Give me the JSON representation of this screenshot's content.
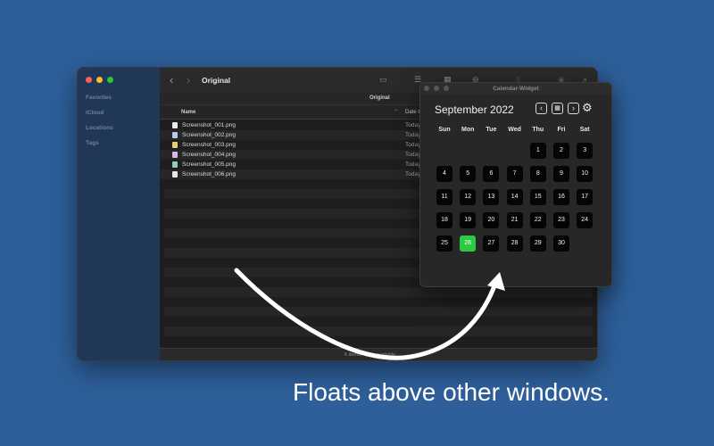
{
  "colors": {
    "background": "#2e5f9a",
    "sidebar": "#213757",
    "today": "#2ec944"
  },
  "finder": {
    "sidebar": [
      "Favorites",
      "iCloud",
      "Locations",
      "Tags"
    ],
    "title": "Original",
    "path_label": "Original",
    "columns": {
      "name": "Name",
      "date": "Date C"
    },
    "files": [
      {
        "name": "Screenshot_001.png",
        "date": "Today",
        "icon_color": "#e8e8e8"
      },
      {
        "name": "Screenshot_002.png",
        "date": "Today",
        "icon_color": "#b9c7e8"
      },
      {
        "name": "Screenshot_003.png",
        "date": "Today",
        "icon_color": "#e8cf6a"
      },
      {
        "name": "Screenshot_004.png",
        "date": "Today",
        "icon_color": "#d9b7e6"
      },
      {
        "name": "Screenshot_005.png",
        "date": "Today",
        "icon_color": "#8fd0b4"
      },
      {
        "name": "Screenshot_006.png",
        "date": "Today",
        "icon_color": "#e8e8e8"
      }
    ],
    "status": "6 items, 4,3… available"
  },
  "calendar": {
    "window_title": "Calendar-Widget",
    "month_label": "September 2022",
    "weekdays": [
      "Sun",
      "Mon",
      "Tue",
      "Wed",
      "Thu",
      "Fri",
      "Sat"
    ],
    "first_weekday_index": 4,
    "days_in_month": 30,
    "today": 26,
    "icons": {
      "prev": "chevron-left-icon",
      "today": "calendar-grid-icon",
      "next": "chevron-right-icon",
      "settings": "gear-icon"
    }
  },
  "caption": "Floats above other windows."
}
